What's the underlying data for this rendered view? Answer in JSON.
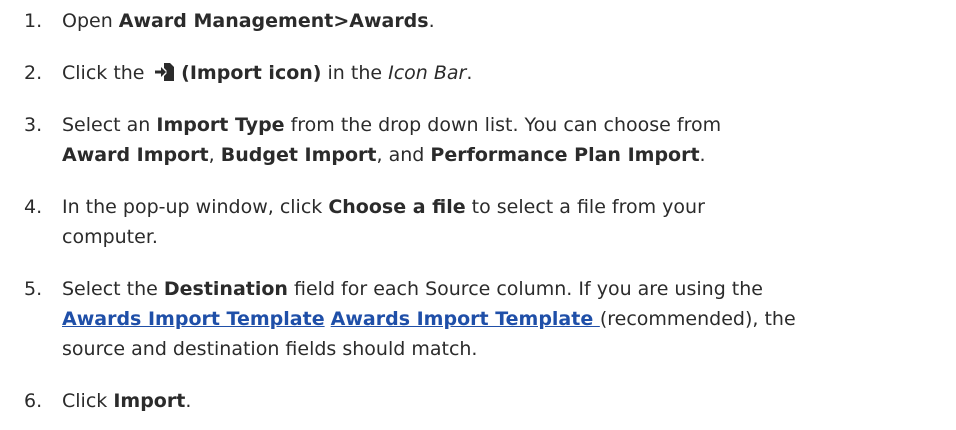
{
  "steps": [
    {
      "num": "1.",
      "t1": "Open ",
      "b1": "Award Management>Awards",
      "t2": "."
    },
    {
      "num": "2.",
      "t1": "Click the ",
      "icon": "import-icon",
      "b1": " (Import icon)",
      "t2": " in the ",
      "i1": "Icon Bar",
      "t3": "."
    },
    {
      "num": "3.",
      "t1": "Select an ",
      "b1": "Import Type",
      "t2": " from the drop down list. You can choose from",
      "b2": "Award Import",
      "t3": ", ",
      "b3": "Budget Import",
      "t4": ", and ",
      "b4": "Performance Plan Import",
      "t5": "."
    },
    {
      "num": "4.",
      "t1": "In the pop-up window, click ",
      "b1": "Choose a file",
      "t2": " to select a file from your",
      "t3": "computer."
    },
    {
      "num": "5.",
      "t1": "Select the ",
      "b1": "Destination",
      "t2": " field for each Source column. If you are using the",
      "link1": "Awards Import Template",
      "t3": " ",
      "link2": "Awards Import Template ",
      "t4": "(recommended), the",
      "t5": "source and destination fields should match."
    },
    {
      "num": "6.",
      "t1": "Click ",
      "b1": "Import",
      "t2": "."
    }
  ]
}
